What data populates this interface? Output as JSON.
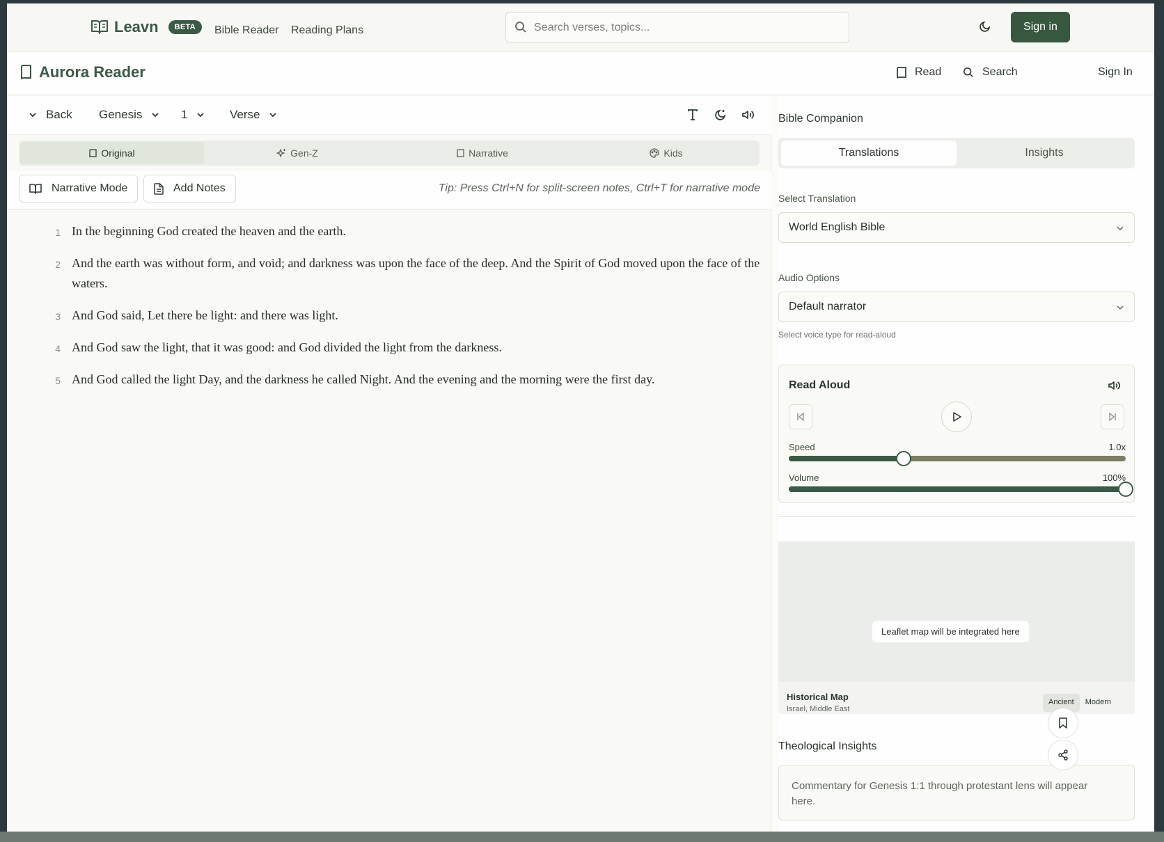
{
  "navbar": {
    "brand": "Leavn",
    "badge": "BETA",
    "links": [
      "Bible Reader",
      "Reading Plans"
    ],
    "search_placeholder": "Search verses, topics...",
    "signin_label": "Sign in"
  },
  "app_header": {
    "title": "Aurora Reader",
    "buttons": {
      "read": "Read",
      "search": "Search",
      "signin": "Sign In"
    }
  },
  "reader_toolbar": {
    "back_label": "Back",
    "book": "Genesis",
    "chapter": "1",
    "verse": "Verse"
  },
  "modes": [
    {
      "label": "Original",
      "icon": "book-icon",
      "active": true
    },
    {
      "label": "Gen-Z",
      "icon": "sparkles-icon",
      "active": false
    },
    {
      "label": "Narrative",
      "icon": "book-icon",
      "active": false
    },
    {
      "label": "Kids",
      "icon": "palette-icon",
      "active": false
    }
  ],
  "actions": {
    "narrative_mode": "Narrative Mode",
    "add_notes": "Add Notes",
    "tip": "Tip: Press Ctrl+N for split-screen notes, Ctrl+T for narrative mode"
  },
  "verses": [
    {
      "num": "1",
      "text": "In the beginning God created the heaven and the earth."
    },
    {
      "num": "2",
      "text": "And the earth was without form, and void; and darkness was upon the face of the deep. And the Spirit of God moved upon the face of the waters."
    },
    {
      "num": "3",
      "text": "And God said, Let there be light: and there was light."
    },
    {
      "num": "4",
      "text": "And God saw the light, that it was good: and God divided the light from the darkness."
    },
    {
      "num": "5",
      "text": "And God called the light Day, and the darkness he called Night. And the evening and the morning were the first day."
    }
  ],
  "companion": {
    "title": "Bible Companion",
    "tabs": [
      {
        "label": "Translations",
        "active": true
      },
      {
        "label": "Insights",
        "active": false
      }
    ],
    "translation_label": "Select Translation",
    "translation_value": "World English Bible",
    "audio_label": "Audio Options",
    "audio_value": "Default narrator",
    "audio_hint": "Select voice type for read-aloud",
    "read_aloud": {
      "title": "Read Aloud",
      "speed_label": "Speed",
      "speed_value": "1.0x",
      "speed_fraction": 0.34,
      "volume_label": "Volume",
      "volume_value": "100%",
      "volume_fraction": 1.0
    },
    "map": {
      "placeholder": "Leaflet map will be integrated here",
      "title": "Historical Map",
      "subtitle": "Israel, Middle East",
      "toggle": [
        "Ancient",
        "Modern"
      ],
      "active_toggle": "Ancient"
    },
    "theological": {
      "title": "Theological Insights",
      "text": "Commentary for Genesis 1:1 through protestant lens will appear here."
    }
  },
  "colors": {
    "brand": "#37583f",
    "background": "#fbfbf8"
  }
}
